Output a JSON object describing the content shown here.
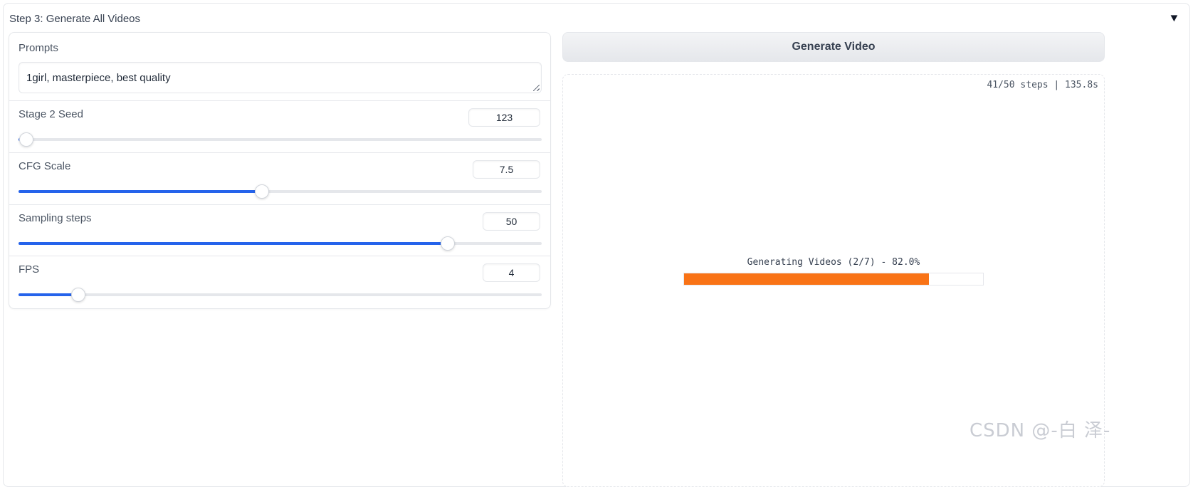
{
  "accordion": {
    "title": "Step 3: Generate All Videos",
    "toggle_glyph": "▼"
  },
  "prompts": {
    "label": "Prompts",
    "value": "1girl, masterpiece, best quality"
  },
  "sliders": [
    {
      "label": "Stage 2 Seed",
      "value": "123",
      "fraction": 0.015
    },
    {
      "label": "CFG Scale",
      "value": "7.5",
      "fraction": 0.465
    },
    {
      "label": "Sampling steps",
      "value": "50",
      "fraction": 0.82
    },
    {
      "label": "FPS",
      "value": "4",
      "fraction": 0.114
    }
  ],
  "generate_button": {
    "label": "Generate Video"
  },
  "output": {
    "timer": "41/50 steps | 135.8s",
    "progress_label": "Generating Videos (2/7) - 82.0%",
    "progress_fraction": 0.82,
    "progress_color": "#f97316"
  },
  "watermark": "CSDN @-白 泽-"
}
